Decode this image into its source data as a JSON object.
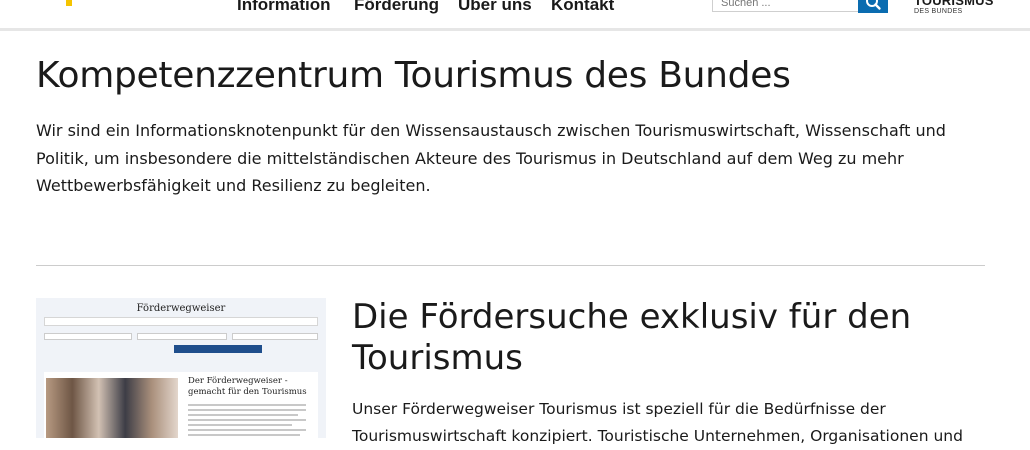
{
  "header": {
    "nav": [
      {
        "label": "Information"
      },
      {
        "label": "Förderung"
      },
      {
        "label": "Über uns"
      },
      {
        "label": "Kontakt"
      }
    ],
    "search_placeholder": "Suchen ...",
    "search_icon": "magnifier-icon",
    "brand_title": "TOURISMUS",
    "brand_subtitle": "DES BUNDES",
    "logo_color": "#f5c400",
    "accent_color": "#0a6cb0"
  },
  "main": {
    "title": "Kompetenzzentrum Tourismus des Bundes",
    "intro": "Wir sind ein Informationsknotenpunkt für den Wissensaustausch zwischen Tourismuswirtschaft, Wissenschaft und Politik, um insbesondere die mittelständischen Akteure des Tourismus in Deutschland auf dem Weg zu mehr Wettbewerbsfähigkeit und Resilienz zu begleiten."
  },
  "promo": {
    "thumbnail": {
      "title": "Förderwegweiser",
      "card_heading": "Der Förderwegweiser - gemacht für den Tourismus"
    },
    "title": "Die Fördersuche exklusiv für den Tourismus",
    "text": "Unser Förderwegweiser Tourismus ist speziell für die Bedürfnisse der Tourismuswirtschaft konzipiert. Touristische Unternehmen, Organisationen und"
  }
}
